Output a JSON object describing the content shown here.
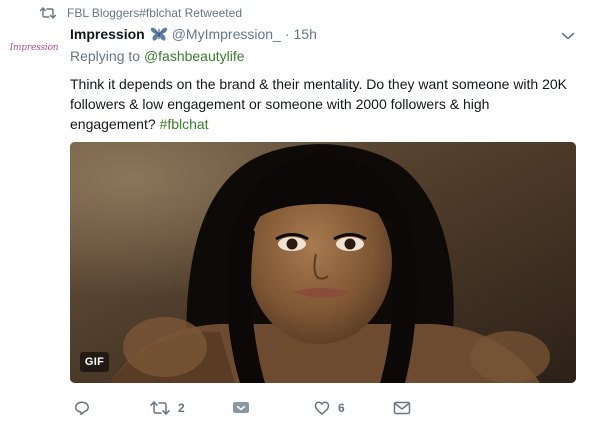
{
  "retweet_context": {
    "text": "FBL Bloggers#fblchat Retweeted",
    "icon": "retweet-icon"
  },
  "author": {
    "avatar_text": "Impression",
    "name": "Impression",
    "name_emoji": "butterfly-icon",
    "handle": "@MyImpression_",
    "separator": "·",
    "time": "15h"
  },
  "reply": {
    "prefix": "Replying to",
    "to": "@fashbeautylife"
  },
  "tweet": {
    "text": "Think it depends on the brand & their mentality. Do they want someone with 20K followers & low engagement or someone with 2000 followers & high engagement?",
    "hashtag": "#fblchat"
  },
  "media": {
    "badge": "GIF"
  },
  "actions": {
    "reply_count": "",
    "retweet_count": "2",
    "like_count": "6"
  },
  "colors": {
    "link": "#3a7c2d",
    "muted": "#657786",
    "text": "#14171a"
  }
}
